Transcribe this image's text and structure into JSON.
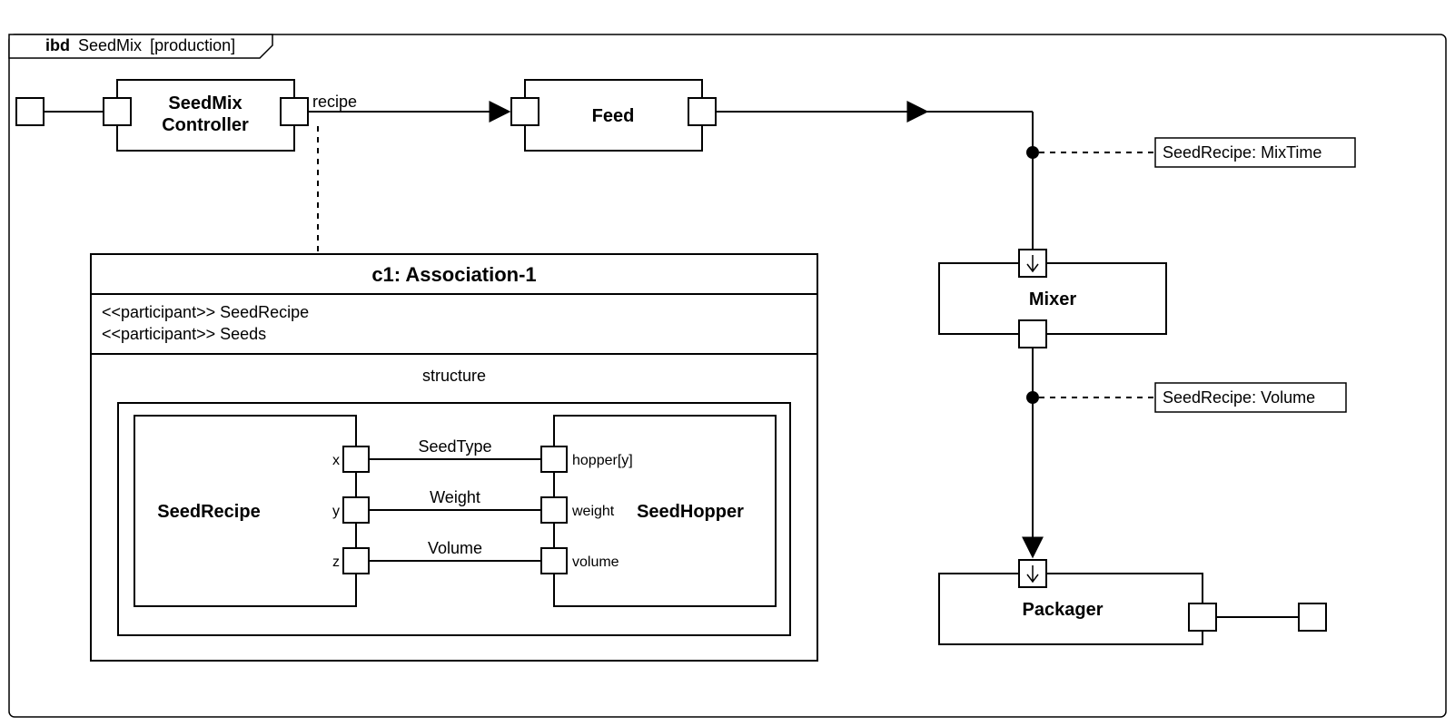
{
  "frame": {
    "prefix": "ibd",
    "name": "SeedMix",
    "suffix": "[production]"
  },
  "blocks": {
    "controller": "SeedMix\nController",
    "feed": "Feed",
    "mixer": "Mixer",
    "packager": "Packager"
  },
  "connLabels": {
    "recipe": "recipe",
    "mixtime": "SeedRecipe: MixTime",
    "volume": "SeedRecipe: Volume"
  },
  "assoc": {
    "title": "c1: Association-1",
    "p1": "<<participant>> SeedRecipe",
    "p2": "<<participant>> Seeds",
    "compartment": "structure",
    "left": "SeedRecipe",
    "right": "SeedHopper",
    "leftPorts": {
      "x": "x",
      "y": "y",
      "z": "z"
    },
    "rightPorts": {
      "hy": "hopper[y]",
      "w": "weight",
      "v": "volume"
    },
    "links": {
      "st": "SeedType",
      "wt": "Weight",
      "vl": "Volume"
    }
  }
}
